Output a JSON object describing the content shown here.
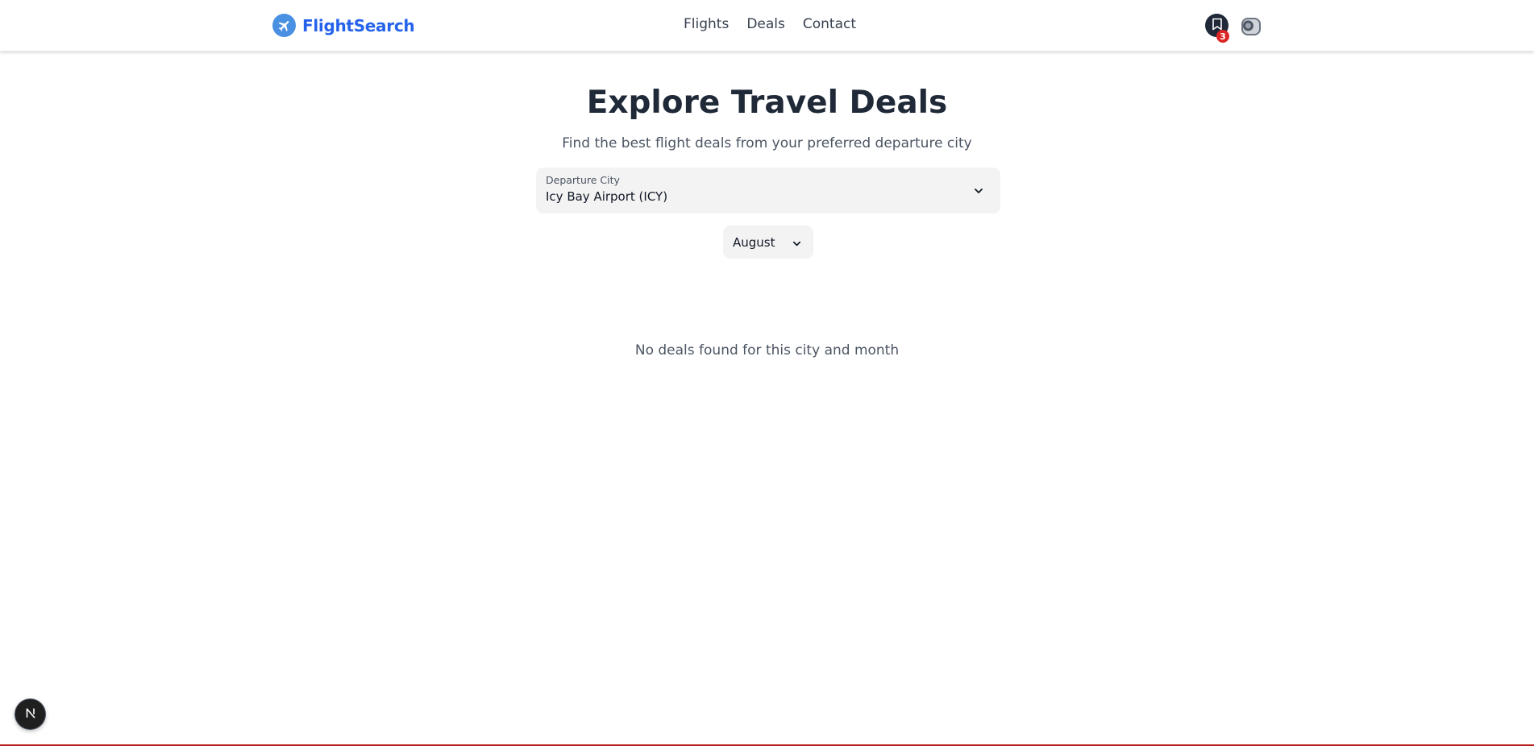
{
  "header": {
    "brand": "FlightSearch",
    "nav": [
      {
        "label": "Flights"
      },
      {
        "label": "Deals"
      },
      {
        "label": "Contact"
      }
    ],
    "saved_count": "3",
    "brand_icon": "airplane-icon",
    "saved_icon": "bookmark-icon",
    "brand_color": "#2563eb",
    "badge_color": "#dc2626"
  },
  "main": {
    "title": "Explore Travel Deals",
    "subtitle": "Find the best flight deals from your preferred departure city",
    "departure": {
      "label": "Departure City",
      "value": "Icy Bay Airport (ICY)"
    },
    "month": {
      "value": "August"
    },
    "empty_message": "No deals found for this city and month"
  },
  "dev_indicator": {
    "icon": "next-logo-icon"
  }
}
